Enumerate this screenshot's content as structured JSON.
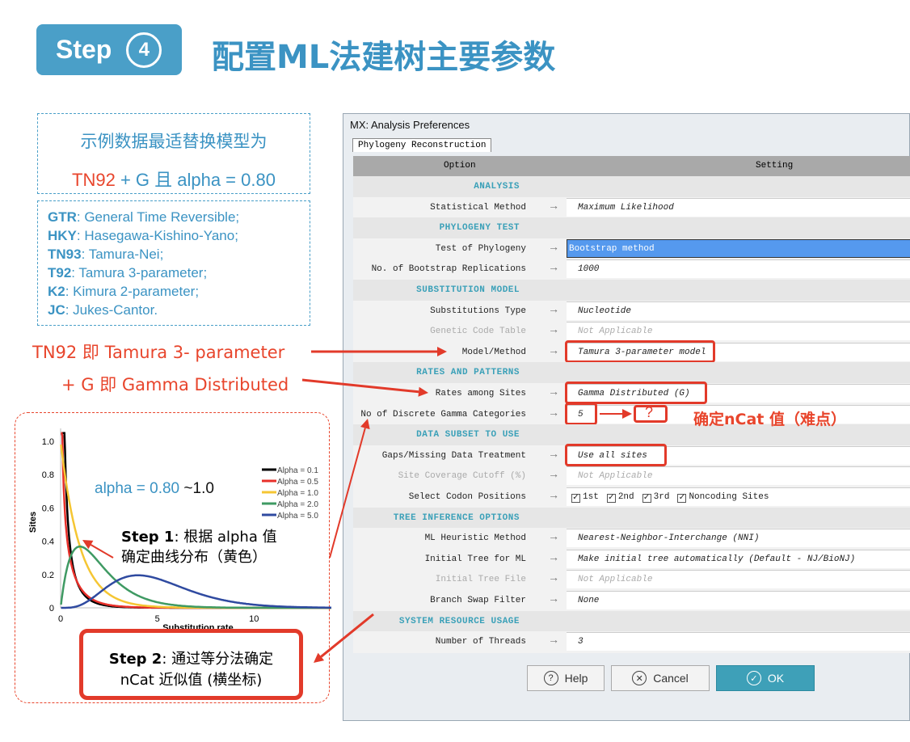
{
  "header": {
    "step_label": "Step",
    "step_number": "4",
    "title": "配置ML法建树主要参数"
  },
  "best_model": {
    "line1": "示例数据最适替换模型为",
    "model": "TN92",
    "rest": " + G 且 alpha  = 0.80"
  },
  "legend_box": [
    {
      "abbr": "GTR",
      "desc": ": General Time Reversible;"
    },
    {
      "abbr": "HKY",
      "desc": ": Hasegawa-Kishino-Yano;"
    },
    {
      "abbr": "TN93",
      "desc": ": Tamura-Nei;"
    },
    {
      "abbr": "T92",
      "desc": ": Tamura 3-parameter;"
    },
    {
      "abbr": "K2",
      "desc": ": Kimura 2-parameter;"
    },
    {
      "abbr": "JC",
      "desc": ": Jukes-Cantor."
    }
  ],
  "annotations": {
    "tn92": "TN92 即 Tamura 3- parameter",
    "gamma": "+ G 即 Gamma Distributed",
    "ncat": "确定nCat 值（难点）",
    "question": "?",
    "alpha_range": "alpha  = 0.80 ",
    "alpha_range_end": "~1.0",
    "step1_bold": "Step 1",
    "step1_text": ": 根据 alpha 值",
    "step1_line2": "确定曲线分布（黄色）",
    "step2_bold": "Step 2",
    "step2_text": ": 通过等分法确定",
    "step2_line2": "nCat 近似值 (横坐标)"
  },
  "chart_data": {
    "type": "line",
    "ylabel": "Sites",
    "xlabel": "Substitution rate",
    "xticks": [
      0,
      5,
      10
    ],
    "yticks": [
      "0",
      "0.2",
      "0.4",
      "0.6",
      "0.8",
      "1.0"
    ],
    "xlim": [
      0,
      14
    ],
    "ylim": [
      0,
      1.05
    ],
    "legend_placement": "right",
    "series": [
      {
        "name": "Alpha = 0.1",
        "alpha": 0.1,
        "color": "#000000"
      },
      {
        "name": "Alpha = 0.5",
        "alpha": 0.5,
        "color": "#e8302a"
      },
      {
        "name": "Alpha = 1.0",
        "alpha": 1.0,
        "color": "#f5c633"
      },
      {
        "name": "Alpha = 2.0",
        "alpha": 2.0,
        "color": "#3f9a63"
      },
      {
        "name": "Alpha = 5.0",
        "alpha": 5.0,
        "color": "#2f4aa0"
      }
    ]
  },
  "dialog": {
    "title": "MX: Analysis Preferences",
    "tab": "Phylogeny Reconstruction",
    "col_option": "Option",
    "col_setting": "Setting",
    "rows": [
      {
        "section": "ANALYSIS"
      },
      {
        "option": "Statistical Method",
        "value": "Maximum Likelihood"
      },
      {
        "section": "PHYLOGENY TEST"
      },
      {
        "option": "Test of Phylogeny",
        "value": "Bootstrap method",
        "selected": true
      },
      {
        "option": "No. of Bootstrap Replications",
        "value": "1000"
      },
      {
        "section": "SUBSTITUTION MODEL"
      },
      {
        "option": "Substitutions Type",
        "value": "Nucleotide"
      },
      {
        "option": "Genetic Code Table",
        "value": "Not Applicable",
        "disabled": true
      },
      {
        "option": "Model/Method",
        "value": "Tamura 3-parameter model",
        "highlight": true
      },
      {
        "section": "RATES AND PATTERNS"
      },
      {
        "option": "Rates among Sites",
        "value": "Gamma Distributed (G)",
        "highlight": true
      },
      {
        "option": "No of Discrete Gamma Categories",
        "value": "5",
        "highlight": true
      },
      {
        "section": "DATA SUBSET TO USE"
      },
      {
        "option": "Gaps/Missing Data Treatment",
        "value": "Use all sites",
        "highlight": true
      },
      {
        "option": "Site Coverage Cutoff (%)",
        "value": "Not Applicable",
        "disabled": true
      },
      {
        "option": "Select Codon Positions",
        "checks": [
          "1st",
          "2nd",
          "3rd",
          "Noncoding Sites"
        ]
      },
      {
        "section": "TREE INFERENCE OPTIONS"
      },
      {
        "option": "ML Heuristic Method",
        "value": "Nearest-Neighbor-Interchange (NNI)"
      },
      {
        "option": "Initial Tree for ML",
        "value": "Make initial tree automatically (Default - NJ/BioNJ)"
      },
      {
        "option": "Initial Tree File",
        "value": "Not Applicable",
        "disabled": true
      },
      {
        "option": "Branch Swap Filter",
        "value": "None"
      },
      {
        "section": "SYSTEM RESOURCE USAGE"
      },
      {
        "option": "Number of Threads",
        "value": "3"
      }
    ],
    "buttons": {
      "help": "Help",
      "cancel": "Cancel",
      "ok": "OK"
    }
  },
  "colors": {
    "accent": "#4a9fc8",
    "annotation_red": "#e8452c",
    "selection": "#5599ee"
  }
}
